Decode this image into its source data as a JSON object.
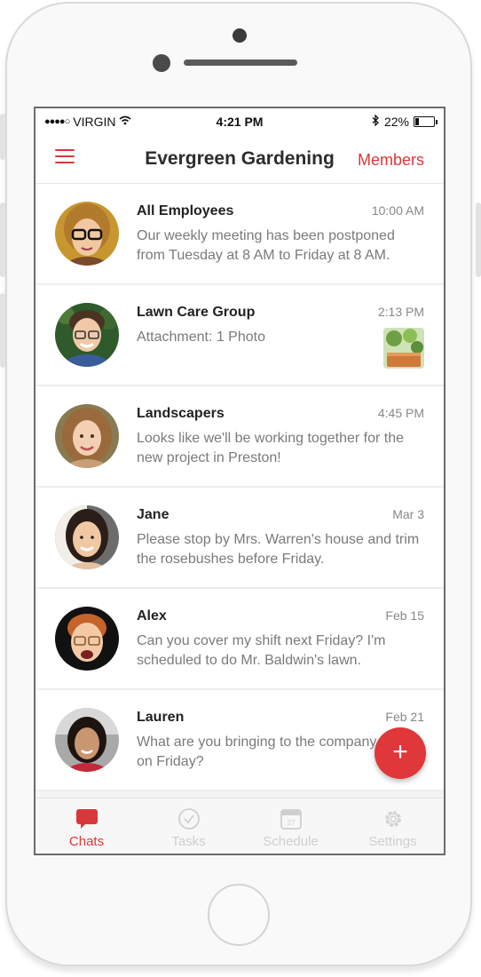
{
  "status_bar": {
    "carrier": "VIRGIN",
    "time": "4:21 PM",
    "battery": "22%",
    "battery_level": 0.22
  },
  "nav": {
    "title": "Evergreen Gardening",
    "members_label": "Members"
  },
  "chats": [
    {
      "name": "All Employees",
      "time": "10:00 AM",
      "preview": "Our weekly meeting has been postponed from Tuesday at 8 AM to Friday at 8 AM."
    },
    {
      "name": "Lawn Care Group",
      "time": "2:13 PM",
      "preview": "Attachment: 1 Photo"
    },
    {
      "name": "Landscapers",
      "time": "4:45 PM",
      "preview": "Looks like we'll be working together for the new project in Preston!"
    },
    {
      "name": "Jane",
      "time": "Mar 3",
      "preview": "Please stop  by Mrs. Warren's house and trim the rosebushes before Friday."
    },
    {
      "name": "Alex",
      "time": "Feb 15",
      "preview": "Can you cover my shift next Friday? I'm scheduled to do Mr. Baldwin's lawn."
    },
    {
      "name": "Lauren",
      "time": "Feb 21",
      "preview": "What are you bringing to the company party on Friday?"
    }
  ],
  "fab": {
    "label": "+"
  },
  "tabs": [
    {
      "label": "Chats",
      "icon": "chat-bubble-icon",
      "active": true
    },
    {
      "label": "Tasks",
      "icon": "check-circle-icon",
      "active": false
    },
    {
      "label": "Schedule",
      "icon": "calendar-icon",
      "active": false,
      "calendar_day": "27"
    },
    {
      "label": "Settings",
      "icon": "gear-icon",
      "active": false
    }
  ],
  "colors": {
    "accent": "#d9383a",
    "fab": "#e0373a"
  }
}
